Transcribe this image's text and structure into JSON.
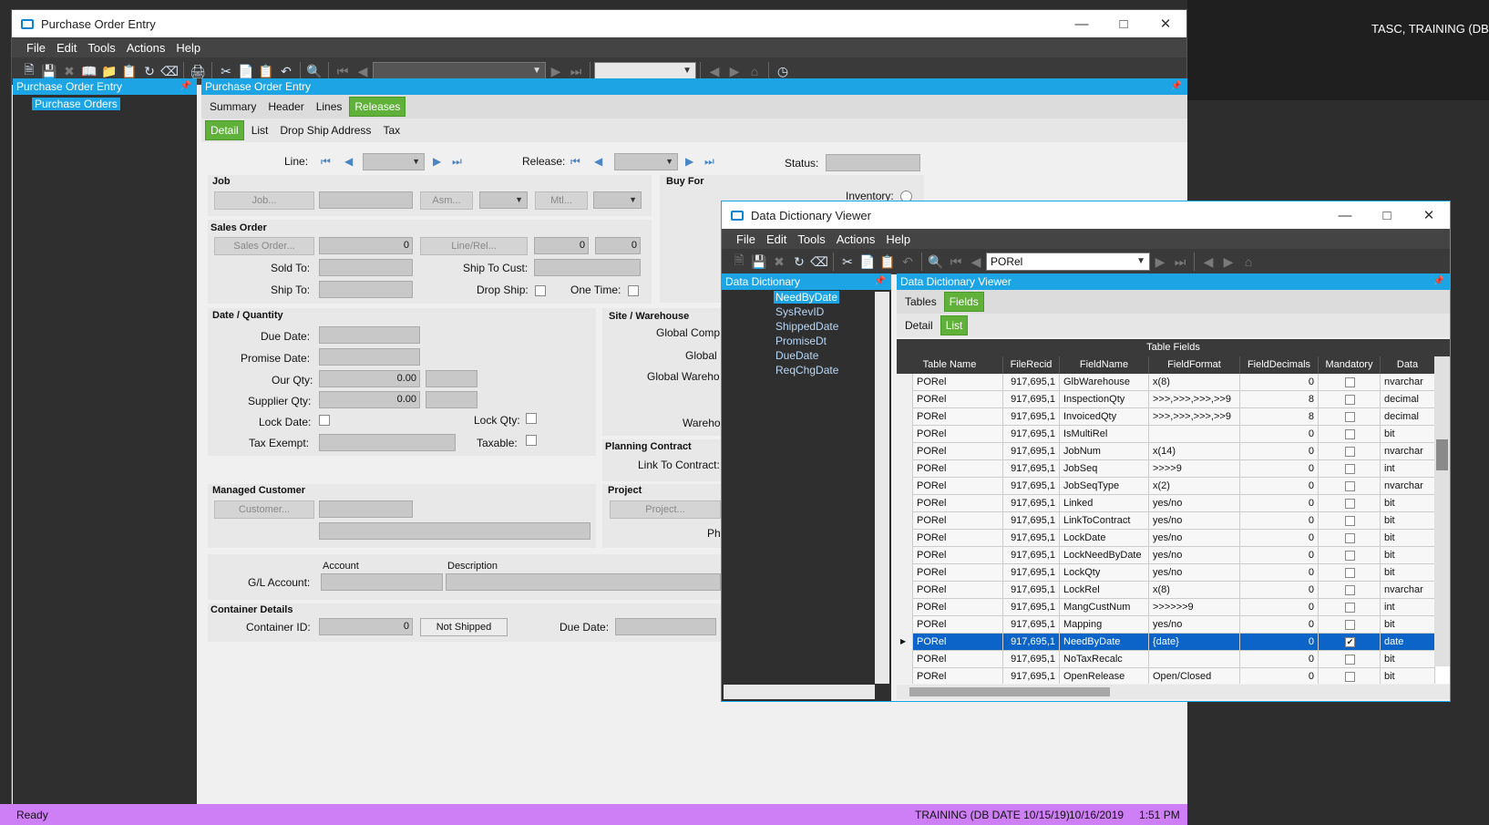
{
  "desktop": {
    "user_text": "TASC, TRAINING (DB DA"
  },
  "main_window": {
    "title": "Purchase Order Entry",
    "menu": [
      "File",
      "Edit",
      "Tools",
      "Actions",
      "Help"
    ],
    "tree_header": "Purchase Order Entry",
    "tree_item": "Purchase Orders",
    "content_header": "Purchase Order Entry",
    "tabs": [
      "Summary",
      "Header",
      "Lines",
      "Releases"
    ],
    "active_tab": "Releases",
    "subtabs": [
      "Detail",
      "List",
      "Drop Ship Address",
      "Tax"
    ],
    "active_subtab": "Detail",
    "line_label": "Line:",
    "release_label": "Release:",
    "status_label": "Status:",
    "job": {
      "title": "Job",
      "job_btn": "Job...",
      "asm_btn": "Asm...",
      "mtl_btn": "Mtl..."
    },
    "buy_for": {
      "title": "Buy For",
      "inventory_label": "Inventory:"
    },
    "sales_order": {
      "title": "Sales Order",
      "sales_order_btn": "Sales Order...",
      "sales_order_value": "0",
      "line_rel_btn": "Line/Rel...",
      "line_value": "0",
      "rel_value": "0",
      "sold_to_label": "Sold To:",
      "ship_to_cust_label": "Ship To Cust:",
      "ship_to_label": "Ship To:",
      "drop_ship_label": "Drop Ship:",
      "one_time_label": "One Time:"
    },
    "date_qty": {
      "title": "Date / Quantity",
      "due_date_label": "Due Date:",
      "promise_date_label": "Promise Date:",
      "our_qty_label": "Our Qty:",
      "our_qty_value": "0.00",
      "supplier_qty_label": "Supplier Qty:",
      "supplier_qty_value": "0.00",
      "lock_date_label": "Lock Date:",
      "lock_qty_label": "Lock Qty:",
      "tax_exempt_label": "Tax Exempt:",
      "taxable_label": "Taxable:"
    },
    "site": {
      "title": "Site / Warehouse",
      "global_comp_label": "Global Comp",
      "global_label": "Global",
      "global_wareho_label": "Global Wareho",
      "wareho_label": "Wareho"
    },
    "planning": {
      "title": "Planning Contract",
      "link_label": "Link To Contract:"
    },
    "managed_customer": {
      "title": "Managed Customer",
      "customer_btn": "Customer..."
    },
    "project": {
      "title": "Project",
      "project_btn": "Project...",
      "ph_label": "Ph"
    },
    "gl": {
      "account_col": "Account",
      "description_col": "Description",
      "gl_label": "G/L Account:"
    },
    "container": {
      "title": "Container Details",
      "container_id_label": "Container ID:",
      "container_id_value": "0",
      "not_shipped_btn": "Not Shipped",
      "due_date_label": "Due Date:"
    },
    "status_bar": {
      "left": "Ready",
      "training": "TRAINING (DB DATE 10/15/19)",
      "date": "10/16/2019",
      "time": "1:51 PM"
    }
  },
  "dd_window": {
    "title": "Data Dictionary Viewer",
    "menu": [
      "File",
      "Edit",
      "Tools",
      "Actions",
      "Help"
    ],
    "combo_value": "PORel",
    "left_header": "Data Dictionary",
    "right_header": "Data Dictionary Viewer",
    "tree_items": [
      "NeedByDate",
      "SysRevID",
      "ShippedDate",
      "PromiseDt",
      "DueDate",
      "ReqChgDate"
    ],
    "selected_tree_item": "NeedByDate",
    "tabs": [
      "Tables",
      "Fields"
    ],
    "active_tab": "Fields",
    "subtabs": [
      "Detail",
      "List"
    ],
    "active_subtab": "List",
    "grid_title": "Table Fields",
    "columns": [
      "Table Name",
      "FileRecid",
      "FieldName",
      "FieldFormat",
      "FieldDecimals",
      "Mandatory",
      "Data"
    ],
    "rows": [
      {
        "table": "PORel",
        "recid": "917,695,1",
        "field": "GlbWarehouse",
        "format": "x(8)",
        "dec": "0",
        "mand": false,
        "type": "nvarchar"
      },
      {
        "table": "PORel",
        "recid": "917,695,1",
        "field": "InspectionQty",
        "format": ">>>,>>>,>>>,>>9",
        "dec": "8",
        "mand": false,
        "type": "decimal"
      },
      {
        "table": "PORel",
        "recid": "917,695,1",
        "field": "InvoicedQty",
        "format": ">>>,>>>,>>>,>>9",
        "dec": "8",
        "mand": false,
        "type": "decimal"
      },
      {
        "table": "PORel",
        "recid": "917,695,1",
        "field": "IsMultiRel",
        "format": "",
        "dec": "0",
        "mand": false,
        "type": "bit"
      },
      {
        "table": "PORel",
        "recid": "917,695,1",
        "field": "JobNum",
        "format": "x(14)",
        "dec": "0",
        "mand": false,
        "type": "nvarchar"
      },
      {
        "table": "PORel",
        "recid": "917,695,1",
        "field": "JobSeq",
        "format": ">>>>9",
        "dec": "0",
        "mand": false,
        "type": "int"
      },
      {
        "table": "PORel",
        "recid": "917,695,1",
        "field": "JobSeqType",
        "format": "x(2)",
        "dec": "0",
        "mand": false,
        "type": "nvarchar"
      },
      {
        "table": "PORel",
        "recid": "917,695,1",
        "field": "Linked",
        "format": "yes/no",
        "dec": "0",
        "mand": false,
        "type": "bit"
      },
      {
        "table": "PORel",
        "recid": "917,695,1",
        "field": "LinkToContract",
        "format": "yes/no",
        "dec": "0",
        "mand": false,
        "type": "bit"
      },
      {
        "table": "PORel",
        "recid": "917,695,1",
        "field": "LockDate",
        "format": "yes/no",
        "dec": "0",
        "mand": false,
        "type": "bit"
      },
      {
        "table": "PORel",
        "recid": "917,695,1",
        "field": "LockNeedByDate",
        "format": "yes/no",
        "dec": "0",
        "mand": false,
        "type": "bit"
      },
      {
        "table": "PORel",
        "recid": "917,695,1",
        "field": "LockQty",
        "format": "yes/no",
        "dec": "0",
        "mand": false,
        "type": "bit"
      },
      {
        "table": "PORel",
        "recid": "917,695,1",
        "field": "LockRel",
        "format": "x(8)",
        "dec": "0",
        "mand": false,
        "type": "nvarchar"
      },
      {
        "table": "PORel",
        "recid": "917,695,1",
        "field": "MangCustNum",
        "format": ">>>>>>9",
        "dec": "0",
        "mand": false,
        "type": "int"
      },
      {
        "table": "PORel",
        "recid": "917,695,1",
        "field": "Mapping",
        "format": "yes/no",
        "dec": "0",
        "mand": false,
        "type": "bit"
      },
      {
        "table": "PORel",
        "recid": "917,695,1",
        "field": "NeedByDate",
        "format": "{date}",
        "dec": "0",
        "mand": true,
        "type": "date"
      },
      {
        "table": "PORel",
        "recid": "917,695,1",
        "field": "NoTaxRecalc",
        "format": "",
        "dec": "0",
        "mand": false,
        "type": "bit"
      },
      {
        "table": "PORel",
        "recid": "917,695,1",
        "field": "OpenRelease",
        "format": "Open/Closed",
        "dec": "0",
        "mand": false,
        "type": "bit"
      }
    ],
    "selected_row": 15
  }
}
